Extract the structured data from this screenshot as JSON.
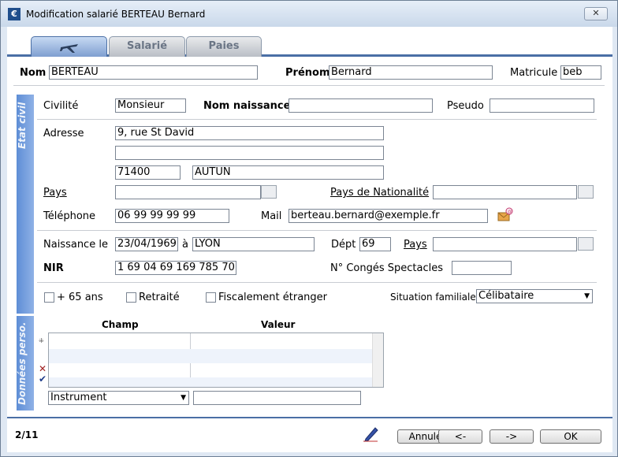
{
  "window": {
    "title": "Modification salarié BERTEAU Bernard",
    "close_label": "✕"
  },
  "tabs": [
    {
      "label": ""
    },
    {
      "label": "Salarié"
    },
    {
      "label": "Paies"
    }
  ],
  "header": {
    "nom_label": "Nom",
    "nom_value": "BERTEAU",
    "prenom_label": "Prénom",
    "prenom_value": "Bernard",
    "matricule_label": "Matricule",
    "matricule_value": "beb"
  },
  "etat_civil": {
    "section_title": "Etat civil",
    "civilite_label": "Civilité",
    "civilite_value": "Monsieur",
    "nom_naissance_label": "Nom naissance",
    "nom_naissance_value": "",
    "pseudo_label": "Pseudo",
    "pseudo_value": "",
    "adresse_label": "Adresse",
    "adresse_line1": "9, rue St David",
    "adresse_line2": "",
    "code_postal": "71400",
    "ville": "AUTUN",
    "pays_label": "Pays",
    "pays_value": "",
    "pays_nationalite_label": "Pays de Nationalité",
    "pays_nationalite_value": "",
    "telephone_label": "Téléphone",
    "telephone_value": "06 99 99 99 99",
    "mail_label": "Mail",
    "mail_value": "berteau.bernard@exemple.fr",
    "naissance_label": "Naissance le",
    "naissance_date": "23/04/1969",
    "a_label": "à",
    "naissance_lieu": "LYON",
    "dept_label": "Dépt",
    "dept_value": "69",
    "pays2_label": "Pays",
    "pays2_value": "",
    "nir_label": "NIR",
    "nir_value": "1 69 04 69 169 785 70",
    "conges_label": "N° Congés Spectacles",
    "conges_value": "",
    "plus65_label": "+ 65 ans",
    "retraite_label": "Retraité",
    "fiscal_label": "Fiscalement étranger",
    "situation_label": "Situation familiale",
    "situation_value": "Célibataire"
  },
  "donnees": {
    "section_title": "Données perso.",
    "col_champ": "Champ",
    "col_valeur": "Valeur",
    "instrument_value": "Instrument",
    "valeur_input": ""
  },
  "footer": {
    "counter": "2/11",
    "annuler_label": "Annuler",
    "prev_label": "<-",
    "next_label": "->",
    "ok_label": "OK"
  }
}
